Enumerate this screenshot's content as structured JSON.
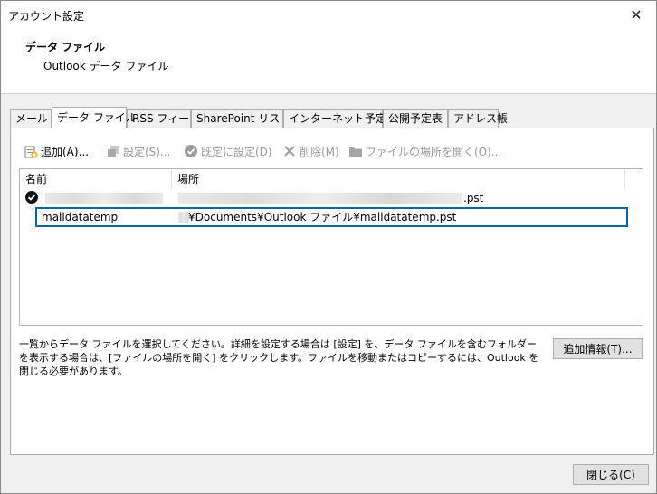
{
  "window": {
    "title": "アカウント設定",
    "close_glyph": "✕"
  },
  "header": {
    "heading": "データ ファイル",
    "subheading": "Outlook データ ファイル"
  },
  "tabs": [
    {
      "label": "メール"
    },
    {
      "label": "データ ファイル"
    },
    {
      "label": "RSS フィード"
    },
    {
      "label": "SharePoint リスト"
    },
    {
      "label": "インターネット予定表"
    },
    {
      "label": "公開予定表"
    },
    {
      "label": "アドレス帳"
    }
  ],
  "toolbar": {
    "add": "追加(A)...",
    "settings": "設定(S)...",
    "set_default": "既定に設定(D)",
    "delete": "削除(M)",
    "open_location": "ファイルの場所を開く(O)..."
  },
  "list": {
    "columns": {
      "name": "名前",
      "location": "場所"
    },
    "rows": [
      {
        "name": "",
        "location": ".pst",
        "default": true
      },
      {
        "name": "maildatatemp",
        "location": "¥Documents¥Outlook ファイル¥maildatatemp.pst",
        "default": false
      }
    ]
  },
  "description": "一覧からデータ ファイルを選択してください。詳細を設定する場合は [設定] を、データ ファイルを含むフォルダーを表示する場合は、[ファイルの場所を開く] をクリックします。ファイルを移動またはコピーするには、Outlook を閉じる必要があります。",
  "buttons": {
    "more_info": "追加情報(T)...",
    "close": "閉じる(C)"
  }
}
